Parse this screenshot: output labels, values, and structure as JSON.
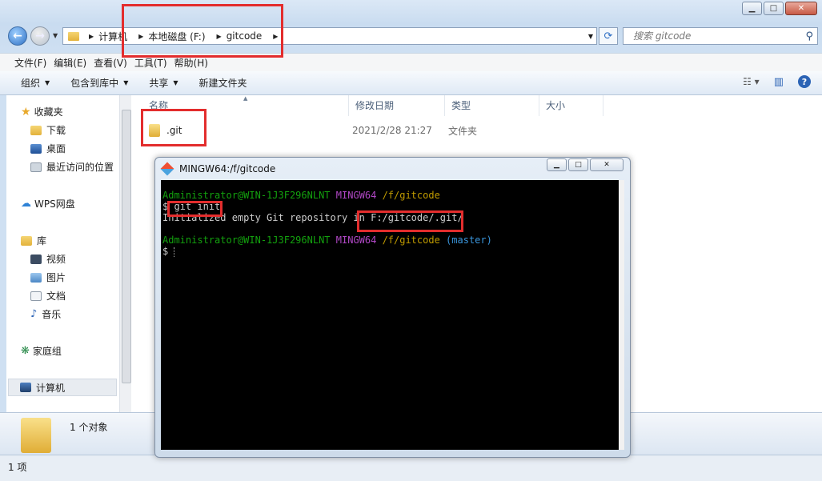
{
  "window": {
    "blurred_title": "",
    "controls": {
      "minimize": "▁",
      "maximize": "□",
      "close": "✕"
    }
  },
  "address": {
    "segments": [
      "计算机",
      "本地磁盘 (F:)",
      "gitcode"
    ],
    "search_placeholder": "搜索 gitcode"
  },
  "menu": [
    "文件(F)",
    "编辑(E)",
    "查看(V)",
    "工具(T)",
    "帮助(H)"
  ],
  "commands": [
    "组织",
    "包含到库中",
    "共享",
    "新建文件夹"
  ],
  "nav": {
    "favorites_header": "收藏夹",
    "favorites": [
      "下载",
      "桌面",
      "最近访问的位置"
    ],
    "wps": "WPS网盘",
    "library_header": "库",
    "libraries": [
      "视频",
      "图片",
      "文档",
      "音乐"
    ],
    "homegroup": "家庭组",
    "computer": "计算机"
  },
  "columns": {
    "name": "名称",
    "date": "修改日期",
    "type": "类型",
    "size": "大小"
  },
  "files": [
    {
      "name": ".git",
      "date": "2021/2/28 21:27",
      "type": "文件夹"
    }
  ],
  "details": {
    "count": "1 个对象"
  },
  "status": {
    "items": "1 项"
  },
  "terminal": {
    "title": "MINGW64:/f/gitcode",
    "lines": [
      {
        "user": "Administrator@WIN-1J3F296NLNT",
        "sys": "MINGW64",
        "path": "/f/gitcode",
        "branch": ""
      },
      {
        "prompt": "$",
        "cmd": "git init"
      },
      {
        "output_a": "Initialized empty Git repository in ",
        "output_b": "F:/gitcode/.git/"
      },
      {
        "user": "Administrator@WIN-1J3F296NLNT",
        "sys": "MINGW64",
        "path": "/f/gitcode",
        "branch": "(master)"
      },
      {
        "prompt": "$"
      }
    ]
  },
  "colors": {
    "annotation_red": "#e32d2d",
    "terminal_green": "#13a10e",
    "terminal_magenta": "#b148c6",
    "terminal_yellow": "#c19c00",
    "terminal_cyan": "#3a96dd"
  }
}
